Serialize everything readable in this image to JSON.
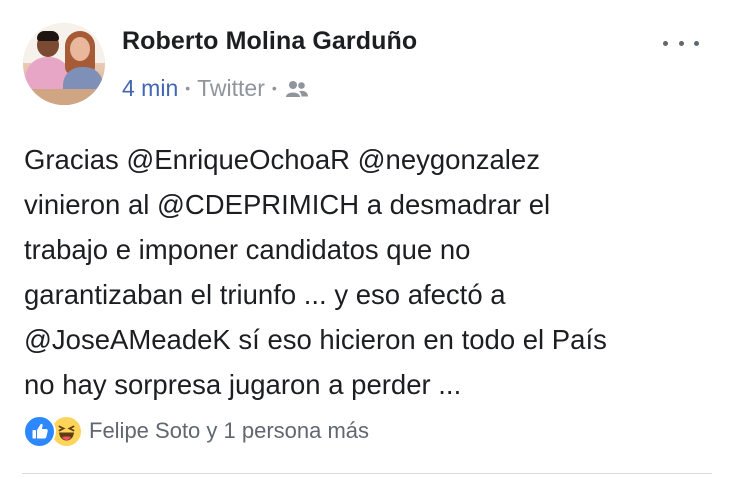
{
  "post": {
    "author": "Roberto Molina Garduño",
    "time": "4 min",
    "separator": "•",
    "source": "Twitter",
    "audience_icon": "friends-icon",
    "more_icon": "more-options-icon",
    "body_lines": [
      "Gracias @EnriqueOchoaR @neygonzalez",
      "vinieron al @CDEPRIMICH a desmadrar el",
      "trabajo e imponer candidatos que no",
      "garantizaban el triunfo ... y eso afectó a",
      "@JoseAMeadeK sí eso hicieron en todo el País",
      "no hay sorpresa jugaron a perder ..."
    ]
  },
  "reactions": {
    "icons": [
      "like-icon",
      "haha-icon"
    ],
    "summary": "Felipe Soto y 1 persona más"
  },
  "colors": {
    "link_blue": "#4267b2",
    "meta_gray": "#90949c",
    "like_blue": "#2d88ff",
    "haha_yellow": "#ffd45a"
  }
}
